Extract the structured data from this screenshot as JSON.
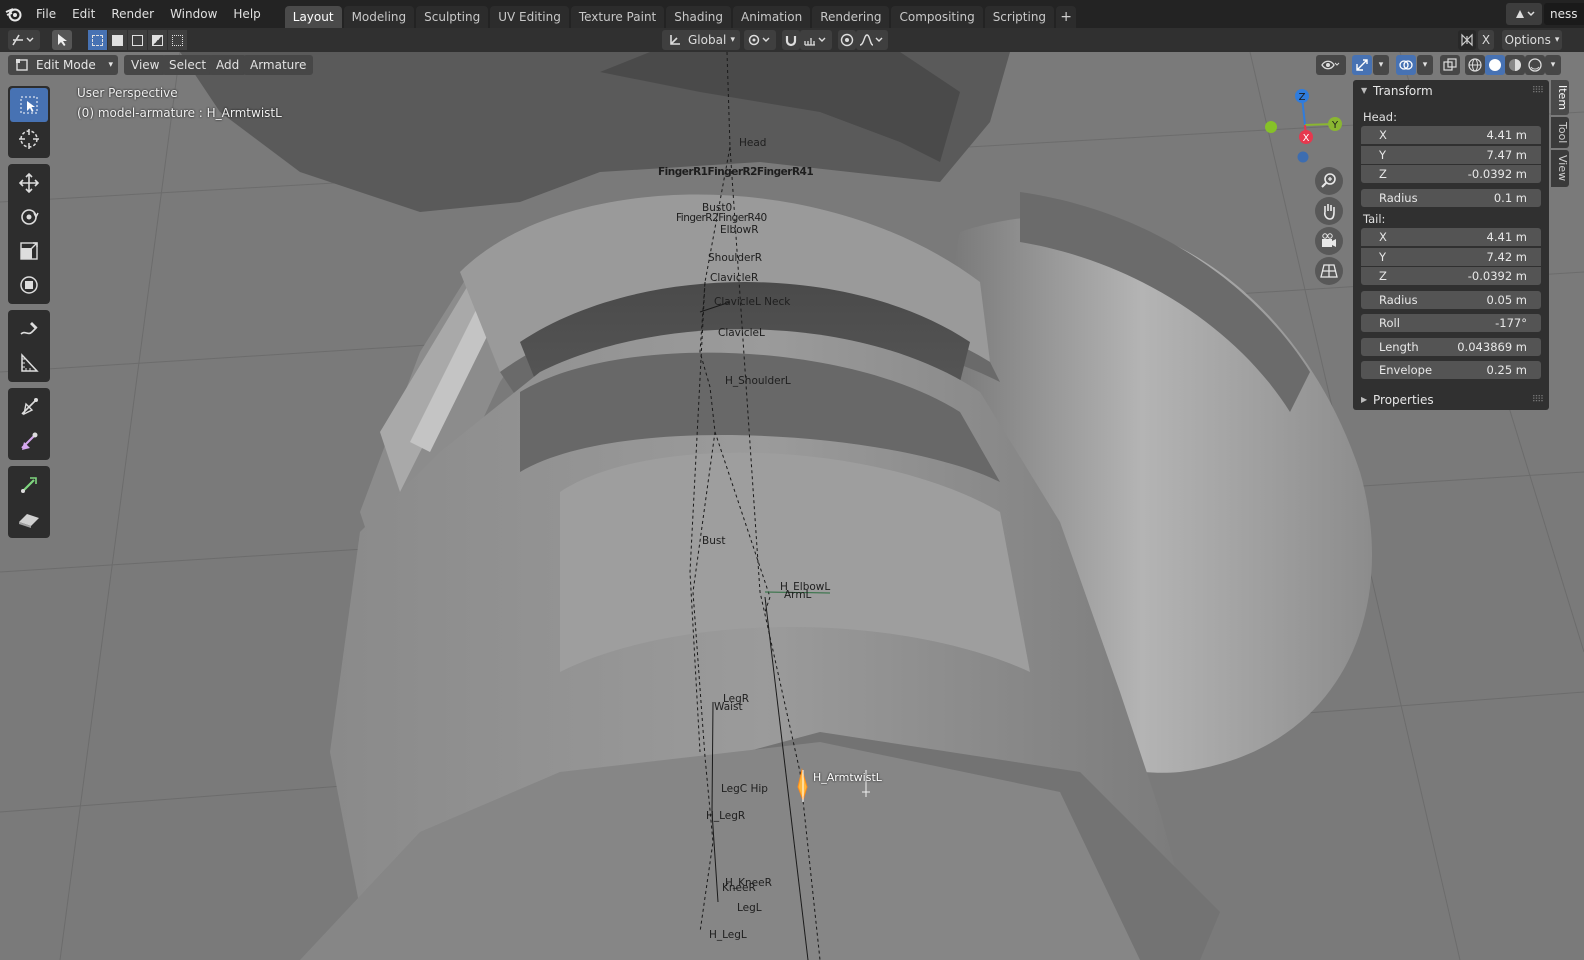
{
  "menu": [
    "File",
    "Edit",
    "Render",
    "Window",
    "Help"
  ],
  "workspaces": [
    {
      "label": "Layout",
      "active": true
    },
    {
      "label": "Modeling",
      "active": false
    },
    {
      "label": "Sculpting",
      "active": false
    },
    {
      "label": "UV Editing",
      "active": false
    },
    {
      "label": "Texture Paint",
      "active": false
    },
    {
      "label": "Shading",
      "active": false
    },
    {
      "label": "Animation",
      "active": false
    },
    {
      "label": "Rendering",
      "active": false
    },
    {
      "label": "Compositing",
      "active": false
    },
    {
      "label": "Scripting",
      "active": false
    }
  ],
  "add_workspace_label": "+",
  "scene_name": "ness",
  "toolheader": {
    "orientation": "Global",
    "x_label": "X",
    "options_label": "Options"
  },
  "viewport_header": {
    "mode": "Edit Mode",
    "menus": [
      "View",
      "Select",
      "Add",
      "Armature"
    ]
  },
  "viewport_info": {
    "perspective": "User Perspective",
    "object": "(0) model-armature : H_ArmtwistL"
  },
  "gizmo_axes": {
    "z": "Z",
    "y": "Y",
    "x": "X"
  },
  "transform_panel": {
    "title": "Transform",
    "head_label": "Head:",
    "head": [
      {
        "label": "X",
        "value": "4.41 m"
      },
      {
        "label": "Y",
        "value": "7.47 m"
      },
      {
        "label": "Z",
        "value": "-0.0392 m"
      }
    ],
    "head_radius": {
      "label": "Radius",
      "value": "0.1 m"
    },
    "tail_label": "Tail:",
    "tail": [
      {
        "label": "X",
        "value": "4.41 m"
      },
      {
        "label": "Y",
        "value": "7.42 m"
      },
      {
        "label": "Z",
        "value": "-0.0392 m"
      }
    ],
    "tail_radius": {
      "label": "Radius",
      "value": "0.05 m"
    },
    "roll": {
      "label": "Roll",
      "value": "-177°"
    },
    "length": {
      "label": "Length",
      "value": "0.043869 m"
    },
    "envelope": {
      "label": "Envelope",
      "value": "0.25 m"
    }
  },
  "properties_panel_title": "Properties",
  "side_tabs": [
    "Item",
    "Tool",
    "View"
  ],
  "bones": {
    "head": "Head",
    "finger_cluster": "FingerR1FingerR2FingerR41",
    "bust_upper": "Bust0",
    "finger_cluster2": "FingerR2FingerR40",
    "elbow_r": "ElbowR",
    "shoulder_r": "ShoulderR",
    "clavicle_r": "ClavicleR",
    "neck": "ClavicleL Neck",
    "clavicle_l": "ClavicleL",
    "shoulder_l": "H_ShoulderL",
    "bust": "Bust",
    "elbow_l": "H_ElbowL",
    "arm_l": "ArmL",
    "leg_r": "LegR",
    "waist": "Waist",
    "active": "H_ArmtwistL",
    "hip": "LegC Hip",
    "h_leg_r": "H_LegR",
    "h_knee_r": "H_KneeR",
    "knee_r": "KneeR",
    "leg_l": "LegL",
    "h_leg_l": "H_LegL"
  }
}
